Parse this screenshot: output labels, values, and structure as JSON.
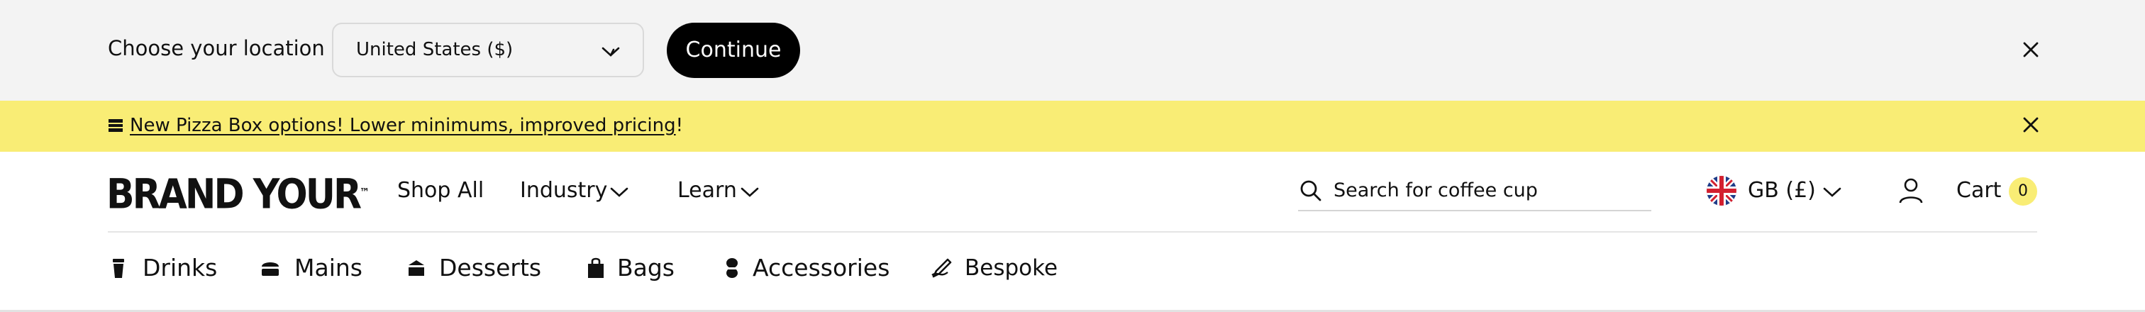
{
  "location_bar": {
    "label": "Choose your location",
    "selected_country": "United States ($)",
    "continue_label": "Continue"
  },
  "promo": {
    "link_text": "New Pizza Box options! Lower minimums, improved pricing",
    "trailing_text": "!"
  },
  "header": {
    "logo_text": "BRAND YOUR",
    "logo_mark": "™",
    "nav": [
      {
        "label": "Shop All"
      },
      {
        "label": "Industry"
      },
      {
        "label": "Learn"
      }
    ],
    "search_placeholder": "Search for coffee cup",
    "currency": "GB (£)",
    "cart_label": "Cart",
    "cart_count": "0"
  },
  "categories": [
    {
      "label": "Drinks",
      "icon": "cup-icon"
    },
    {
      "label": "Mains",
      "icon": "burger-box-icon"
    },
    {
      "label": "Desserts",
      "icon": "cake-icon"
    },
    {
      "label": "Bags",
      "icon": "bag-icon"
    },
    {
      "label": "Accessories",
      "icon": "accessories-icon"
    },
    {
      "label": "Bespoke",
      "icon": "pen-icon"
    }
  ],
  "colors": {
    "accent_yellow": "#f9ed75",
    "location_bg": "#f3f3f3",
    "button_black": "#000000"
  }
}
